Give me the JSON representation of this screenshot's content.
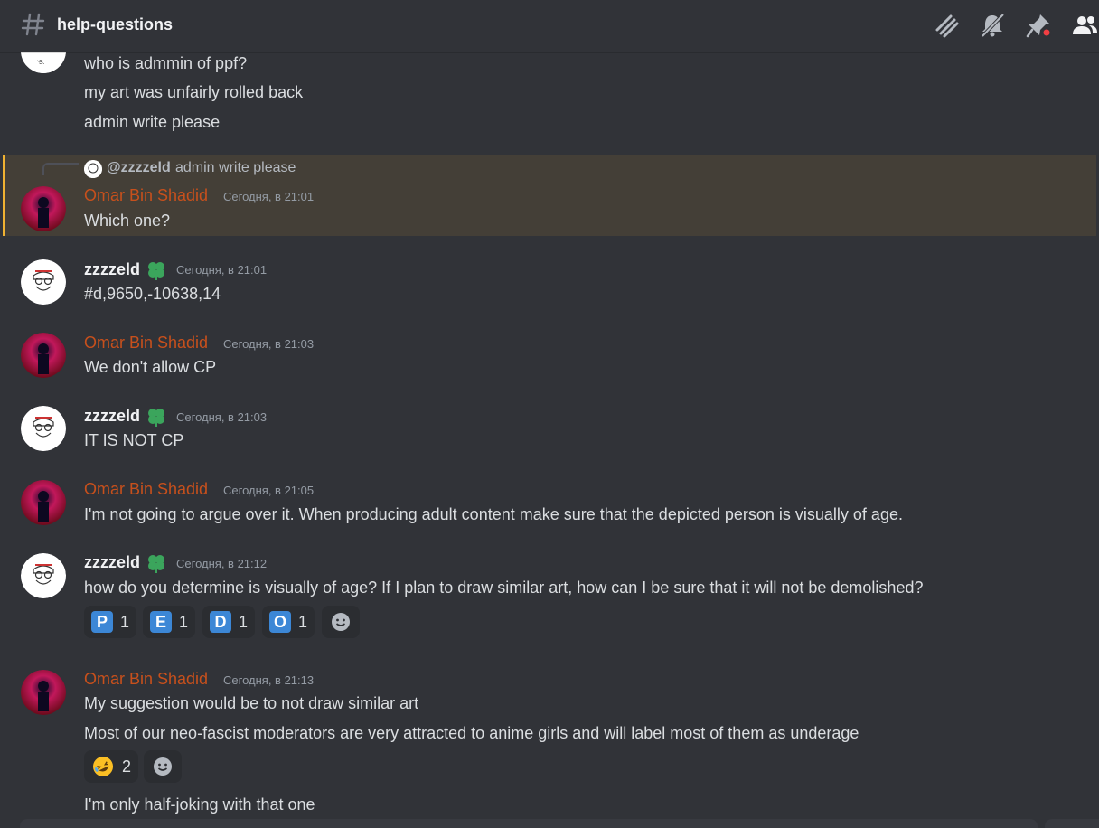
{
  "channel": {
    "name": "help-questions",
    "icon": "hash-icon"
  },
  "toolbar": {
    "icons": [
      "threads-icon",
      "mute-bell-icon",
      "pin-icon",
      "members-icon"
    ],
    "unread_dot_color": "#f23f43"
  },
  "colors": {
    "omar_name": "#c7501c",
    "highlight_bar": "#f0b232",
    "background": "#313338"
  },
  "messages": {
    "m0": {
      "lines": [
        "who is admmin of ppf?",
        "my art was unfairly rolled back",
        "admin write please"
      ]
    },
    "m1": {
      "reply": {
        "user": "@zzzzeld",
        "text": "admin write please"
      },
      "author": "Omar Bin Shadid",
      "time": "Сегодня, в 21:01",
      "text": "Which one?"
    },
    "m2": {
      "author": "zzzzeld",
      "time": "Сегодня, в 21:01",
      "text": "#d,9650,-10638,14"
    },
    "m3": {
      "author": "Omar Bin Shadid",
      "time": "Сегодня, в 21:03",
      "text": "We don't allow CP"
    },
    "m4": {
      "author": "zzzzeld",
      "time": "Сегодня, в 21:03",
      "text": "IT IS NOT CP"
    },
    "m5": {
      "author": "Omar Bin Shadid",
      "time": "Сегодня, в 21:05",
      "text": "I'm not going to argue over it. When producing adult content make sure that the depicted person is visually of age."
    },
    "m6": {
      "author": "zzzzeld",
      "time": "Сегодня, в 21:12",
      "text": "how do you determine is visually of age? If I plan to draw similar art, how can I be sure that it will not be demolished?",
      "reactions": [
        {
          "emoji": "P",
          "count": "1"
        },
        {
          "emoji": "E",
          "count": "1"
        },
        {
          "emoji": "D",
          "count": "1"
        },
        {
          "emoji": "O",
          "count": "1"
        }
      ]
    },
    "m7": {
      "author": "Omar Bin Shadid",
      "time": "Сегодня, в 21:13",
      "lines": [
        "My suggestion would be to not draw similar art",
        "Most of our neo-fascist moderators are very attracted to anime girls and will label most of them as underage"
      ],
      "reactions": [
        {
          "emoji": "rofl-emoji",
          "count": "2"
        }
      ],
      "followup": "I'm only half-joking with that one"
    }
  }
}
